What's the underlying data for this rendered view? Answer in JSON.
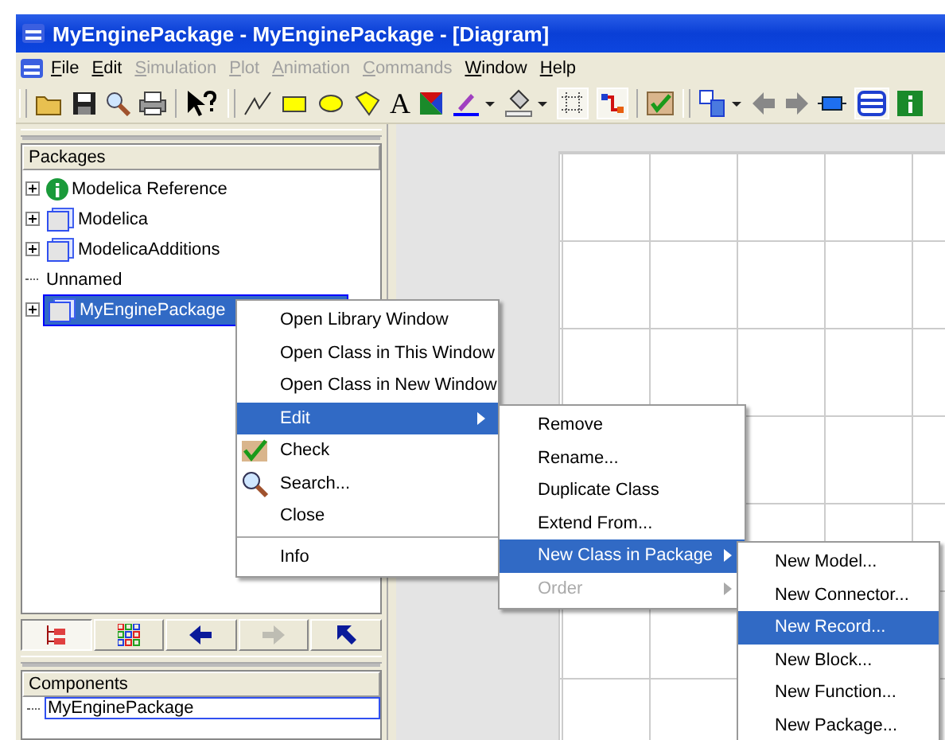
{
  "window": {
    "title": "MyEnginePackage - MyEnginePackage  - [Diagram]"
  },
  "menubar": [
    {
      "label": "File",
      "disabled": false
    },
    {
      "label": "Edit",
      "disabled": false
    },
    {
      "label": "Simulation",
      "disabled": true
    },
    {
      "label": "Plot",
      "disabled": true
    },
    {
      "label": "Animation",
      "disabled": true
    },
    {
      "label": "Commands",
      "disabled": true
    },
    {
      "label": "Window",
      "disabled": false
    },
    {
      "label": "Help",
      "disabled": false
    }
  ],
  "toolbar": {
    "text_tool": "A"
  },
  "packages": {
    "header": "Packages",
    "items": [
      {
        "label": "Modelica Reference",
        "kind": "info",
        "expandable": true,
        "selected": false
      },
      {
        "label": "Modelica",
        "kind": "package",
        "expandable": true,
        "selected": false
      },
      {
        "label": "ModelicaAdditions",
        "kind": "package",
        "expandable": true,
        "selected": false
      },
      {
        "label": "Unnamed",
        "kind": "plain",
        "expandable": false,
        "selected": false
      },
      {
        "label": "MyEnginePackage",
        "kind": "package",
        "expandable": true,
        "selected": true
      }
    ]
  },
  "browser_buttons": [
    {
      "selected": true,
      "disabled": false
    },
    {
      "selected": false,
      "disabled": false
    },
    {
      "selected": false,
      "disabled": false
    },
    {
      "selected": false,
      "disabled": true
    },
    {
      "selected": false,
      "disabled": false
    }
  ],
  "components": {
    "header": "Components",
    "items": [
      {
        "label": "MyEnginePackage"
      }
    ]
  },
  "context_menu": [
    {
      "label": "Open Library Window",
      "kind": "plain",
      "selected": false,
      "submenu": false,
      "separator_before": false
    },
    {
      "label": "Open Class in This Window",
      "kind": "plain",
      "selected": false,
      "submenu": false,
      "separator_before": false
    },
    {
      "label": "Open Class in New Window",
      "kind": "plain",
      "selected": false,
      "submenu": false,
      "separator_before": false
    },
    {
      "label": "Edit",
      "kind": "plain",
      "selected": true,
      "submenu": true,
      "separator_before": false
    },
    {
      "label": "Check",
      "kind": "check",
      "selected": false,
      "submenu": false,
      "separator_before": false
    },
    {
      "label": "Search...",
      "kind": "search",
      "selected": false,
      "submenu": false,
      "separator_before": false
    },
    {
      "label": "Close",
      "kind": "plain",
      "selected": false,
      "submenu": false,
      "separator_before": false
    },
    {
      "label": "Info",
      "kind": "plain",
      "selected": false,
      "submenu": false,
      "separator_before": true
    }
  ],
  "edit_menu": [
    {
      "label": "Remove",
      "selected": false,
      "submenu": false,
      "disabled": false
    },
    {
      "label": "Rename...",
      "selected": false,
      "submenu": false,
      "disabled": false
    },
    {
      "label": "Duplicate Class",
      "selected": false,
      "submenu": false,
      "disabled": false
    },
    {
      "label": "Extend From...",
      "selected": false,
      "submenu": false,
      "disabled": false
    },
    {
      "label": "New Class in Package",
      "selected": true,
      "submenu": true,
      "disabled": false
    },
    {
      "label": "Order",
      "selected": false,
      "submenu": true,
      "disabled": true
    }
  ],
  "new_class_menu": [
    {
      "label": "New Model...",
      "selected": false
    },
    {
      "label": "New Connector...",
      "selected": false
    },
    {
      "label": "New Record...",
      "selected": true
    },
    {
      "label": "New Block...",
      "selected": false
    },
    {
      "label": "New Function...",
      "selected": false
    },
    {
      "label": "New Package...",
      "selected": false
    }
  ]
}
